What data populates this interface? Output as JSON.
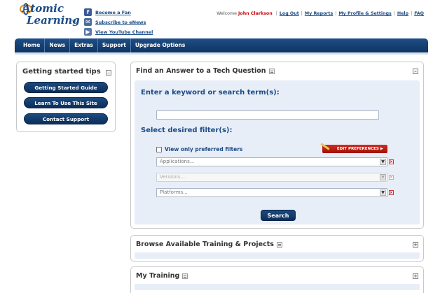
{
  "brand": {
    "logo_top": "Atomic",
    "logo_bottom": "Learning",
    "logo_mark": "SM"
  },
  "social": [
    {
      "icon": "facebook-icon",
      "label": "Become a Fan"
    },
    {
      "icon": "enews-icon",
      "label": "Subscribe to eNews"
    },
    {
      "icon": "youtube-icon",
      "label": "View YouTube Channel"
    }
  ],
  "topnav": {
    "welcome": "Welcome",
    "user": "John Clarkson",
    "links": [
      "Log Out",
      "My Reports",
      "My Profile & Settings",
      "Help",
      "FAQ"
    ]
  },
  "mainnav": [
    "Home",
    "News",
    "Extras",
    "Support",
    "Upgrade Options"
  ],
  "sidebar": {
    "title": "Getting started tips",
    "buttons": [
      "Getting Started Guide",
      "Learn To Use This Site",
      "Contact Support"
    ]
  },
  "search_panel": {
    "title": "Find an Answer to a Tech Question",
    "keyword_label": "Enter a keyword or search term(s):",
    "keyword_value": "",
    "filter_label": "Select desired filter(s):",
    "preferred_label": "View only preferred filters",
    "preferred_checked": false,
    "edit_prefs": "EDIT PREFERENCES",
    "filters": [
      {
        "placeholder": "Applications...",
        "enabled": true
      },
      {
        "placeholder": "Versions...",
        "enabled": false
      },
      {
        "placeholder": "Platforms...",
        "enabled": true
      }
    ],
    "search_button": "Search"
  },
  "browse_panel": {
    "title": "Browse Available Training & Projects"
  },
  "my_training_panel": {
    "title": "My Training"
  },
  "colors": {
    "navy": "#0e3463",
    "accent_red": "#c00000",
    "panel_bg": "#e8eef7"
  }
}
